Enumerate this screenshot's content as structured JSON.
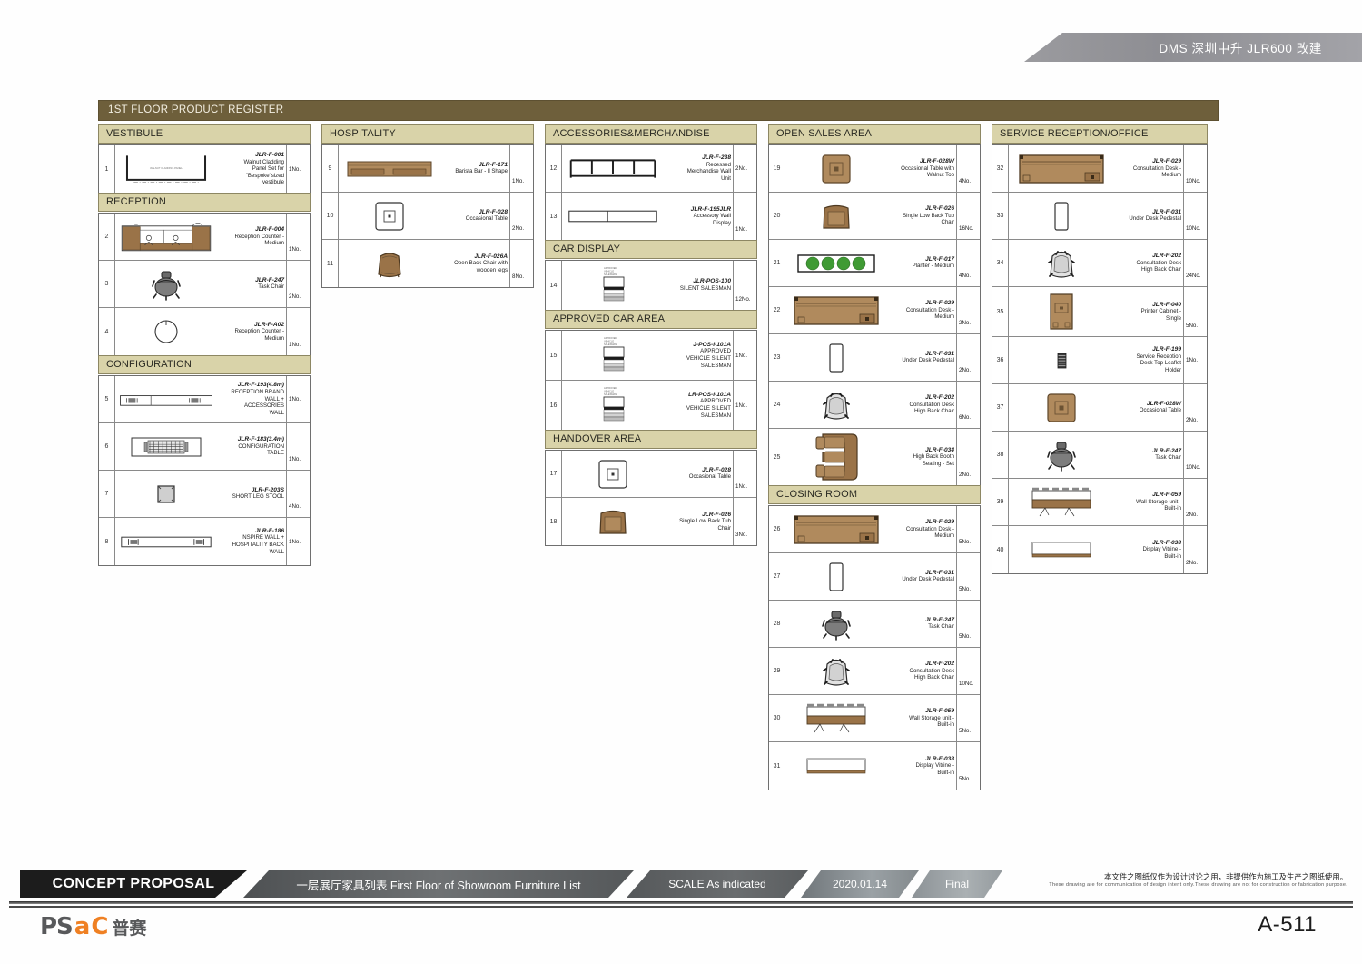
{
  "header": {
    "project_title": "DMS 深圳中升 JLR600 改建"
  },
  "register": {
    "title": "1ST FLOOR PRODUCT REGISTER",
    "columns": [
      {
        "sections": [
          {
            "name": "VESTIBULE",
            "items": [
              {
                "no": "1",
                "code": "JLR-F-001",
                "desc": "Walnut Cladding\nPanel Set for\n\"Bespoke\"sized\nvestibule",
                "qty": "1No.",
                "icon": "vestibule-panel"
              }
            ]
          },
          {
            "name": "RECEPTION",
            "items": [
              {
                "no": "2",
                "code": "JLR-F-004",
                "desc": "Reception Counter -\nMedium",
                "qty": "1No.",
                "icon": "reception-counter"
              },
              {
                "no": "3",
                "code": "JLR-F-247",
                "desc": "Task Chair",
                "qty": "2No.",
                "icon": "task-chair"
              },
              {
                "no": "4",
                "code": "JLR-F-A02",
                "desc": "Reception Counter -\nMedium",
                "qty": "1No.",
                "icon": "round-table"
              }
            ]
          },
          {
            "name": "CONFIGURATION",
            "items": [
              {
                "no": "5",
                "code": "JLR-F-193(4.8m)",
                "desc": "RECEPTION BRAND\nWALL +\nACCESSORIES\nWALL",
                "qty": "1No.",
                "icon": "brand-wall"
              },
              {
                "no": "6",
                "code": "JLR-F-183(3.4m)",
                "desc": "CONFIGURATION\nTABLE",
                "qty": "1No.",
                "icon": "config-table"
              },
              {
                "no": "7",
                "code": "JLR-F-203S",
                "desc": "SHORT LEG STOOL",
                "qty": "4No.",
                "icon": "stool"
              },
              {
                "no": "8",
                "code": "JLR-F-186",
                "desc": "INSPIRE WALL +\nHOSPITALITY BACK\nWALL",
                "qty": "1No.",
                "icon": "inspire-wall"
              }
            ]
          }
        ]
      },
      {
        "sections": [
          {
            "name": "HOSPITALITY",
            "items": [
              {
                "no": "9",
                "code": "JLR-F-171",
                "desc": "Barista Bar - ll Shape",
                "qty": "1No.",
                "icon": "barista-bar"
              },
              {
                "no": "10",
                "code": "JLR-F-028",
                "desc": "Occasional Table",
                "qty": "2No.",
                "icon": "occasional-table-white"
              },
              {
                "no": "11",
                "code": "JLR-F-026A",
                "desc": "Open Back Chair with\nwooden legs",
                "qty": "8No.",
                "icon": "open-back-chair"
              }
            ]
          }
        ]
      },
      {
        "sections": [
          {
            "name": "ACCESSORIES&MERCHANDISE",
            "items": [
              {
                "no": "12",
                "code": "JLR-F-238",
                "desc": "Recessed\nMerchandise Wall\nUnit",
                "qty": "2No.",
                "icon": "merchandise-wall"
              },
              {
                "no": "13",
                "code": "JLR-F-195JLR",
                "desc": "Accessory Wall\nDisplay",
                "qty": "1No.",
                "icon": "accessory-wall"
              }
            ]
          },
          {
            "name": "CAR DISPLAY",
            "items": [
              {
                "no": "14",
                "code": "JLR-POS-100",
                "desc": "SILENT SALESMAN",
                "qty": "12No.",
                "icon": "silent-salesman"
              }
            ]
          },
          {
            "name": "APPROVED CAR AREA",
            "items": [
              {
                "no": "15",
                "code": "J-POS-I-101A",
                "desc": "APPROVED\nVEHICLE SILENT\nSALESMAN",
                "qty": "1No.",
                "icon": "silent-salesman"
              },
              {
                "no": "16",
                "code": "LR-POS-I-101A",
                "desc": "APPROVED\nVEHICLE SILENT\nSALESMAN",
                "qty": "1No.",
                "icon": "silent-salesman"
              }
            ]
          },
          {
            "name": "HANDOVER AREA",
            "items": [
              {
                "no": "17",
                "code": "JLR-F-028",
                "desc": "Occasional Table",
                "qty": "1No.",
                "icon": "occasional-table-white"
              },
              {
                "no": "18",
                "code": "JLR-F-026",
                "desc": "Single Low Back Tub\nChair",
                "qty": "3No.",
                "icon": "tub-chair"
              }
            ]
          }
        ]
      },
      {
        "sections": [
          {
            "name": "OPEN SALES AREA",
            "items": [
              {
                "no": "19",
                "code": "JLR-F-028W",
                "desc": "Occasional Table with\nWalnut Top",
                "qty": "4No.",
                "icon": "occasional-table-walnut"
              },
              {
                "no": "20",
                "code": "JLR-F-026",
                "desc": "Single Low Back Tub\nChair",
                "qty": "16No.",
                "icon": "tub-chair"
              },
              {
                "no": "21",
                "code": "JLR-F-017",
                "desc": "Planter - Medium",
                "qty": "4No.",
                "icon": "planter"
              },
              {
                "no": "22",
                "code": "JLR-F-029",
                "desc": "Consultation Desk -\nMedium",
                "qty": "2No.",
                "icon": "consultation-desk"
              },
              {
                "no": "23",
                "code": "JLR-F-031",
                "desc": "Under Desk Pedestal",
                "qty": "2No.",
                "icon": "pedestal"
              },
              {
                "no": "24",
                "code": "JLR-F-202",
                "desc": "Consultation Desk\nHigh Back Chair",
                "qty": "6No.",
                "icon": "high-back-chair"
              },
              {
                "no": "25",
                "code": "JLR-F-034",
                "desc": "High Back Booth\nSeating - Set",
                "qty": "2No.",
                "icon": "booth-seating"
              }
            ]
          },
          {
            "name": "CLOSING ROOM",
            "items": [
              {
                "no": "26",
                "code": "JLR-F-029",
                "desc": "Consultation Desk -\nMedium",
                "qty": "5No.",
                "icon": "consultation-desk"
              },
              {
                "no": "27",
                "code": "JLR-F-031",
                "desc": "Under Desk Pedestal",
                "qty": "5No.",
                "icon": "pedestal"
              },
              {
                "no": "28",
                "code": "JLR-F-247",
                "desc": "Task Chair",
                "qty": "5No.",
                "icon": "task-chair"
              },
              {
                "no": "29",
                "code": "JLR-F-202",
                "desc": "Consultation Desk\nHigh Back Chair",
                "qty": "10No.",
                "icon": "high-back-chair"
              },
              {
                "no": "30",
                "code": "JLR-F-059",
                "desc": "Wall Storage unit -\nBuilt-in",
                "qty": "5No.",
                "icon": "wall-storage"
              },
              {
                "no": "31",
                "code": "JLR-F-038",
                "desc": "Display Vitrine -\nBuilt-in",
                "qty": "5No.",
                "icon": "display-vitrine"
              }
            ]
          }
        ]
      },
      {
        "sections": [
          {
            "name": "SERVICE RECEPTION/OFFICE",
            "items": [
              {
                "no": "32",
                "code": "JLR-F-029",
                "desc": "Consultation Desk -\nMedium",
                "qty": "10No.",
                "icon": "consultation-desk"
              },
              {
                "no": "33",
                "code": "JLR-F-031",
                "desc": "Under Desk Pedestal",
                "qty": "10No.",
                "icon": "pedestal"
              },
              {
                "no": "34",
                "code": "JLR-F-202",
                "desc": "Consultation Desk\nHigh Back Chair",
                "qty": "24No.",
                "icon": "high-back-chair"
              },
              {
                "no": "35",
                "code": "JLR-F-040",
                "desc": "Printer Cabinet -\nSingle",
                "qty": "5No.",
                "icon": "printer-cabinet"
              },
              {
                "no": "36",
                "code": "JLR-F-199",
                "desc": "Service Reception\nDesk Top Leaflet\nHolder",
                "qty": "1No.",
                "icon": "leaflet-holder"
              },
              {
                "no": "37",
                "code": "JLR-F-028W",
                "desc": "Occasional Table",
                "qty": "2No.",
                "icon": "occasional-table-walnut"
              },
              {
                "no": "38",
                "code": "JLR-F-247",
                "desc": "Task Chair",
                "qty": "10No.",
                "icon": "task-chair"
              },
              {
                "no": "39",
                "code": "JLR-F-059",
                "desc": "Wall Storage unit -\nBuilt-in",
                "qty": "2No.",
                "icon": "wall-storage"
              },
              {
                "no": "40",
                "code": "JLR-F-038",
                "desc": "Display Vitrine -\nBuilt-in",
                "qty": "2No.",
                "icon": "display-vitrine"
              }
            ]
          }
        ]
      }
    ]
  },
  "footer": {
    "concept": "CONCEPT PROPOSAL",
    "drawing_title": "一层展厅家具列表  First Floor of Showroom Furniture List",
    "scale": "SCALE  As indicated",
    "date": "2020.01.14",
    "status": "Final",
    "disclaimer_cn": "本文件之图纸仅作为设计讨论之用，非提供作为施工及生产之图纸使用。",
    "disclaimer_en": "These drawing are for communication of design intent only.These drawing are not for construction or fabrication purpose.",
    "sheet_number": "A-511",
    "logo_part1": "PS",
    "logo_part2": "a",
    "logo_part3": "C",
    "logo_cn": "普赛"
  },
  "colors": {
    "title_bar": "#6e5f3b",
    "section_head": "#d9d3a9",
    "walnut": "#9a7348",
    "walnut_light": "#b08a5d",
    "planter_green": "#3f9a34",
    "accent_orange": "#ef8023"
  }
}
